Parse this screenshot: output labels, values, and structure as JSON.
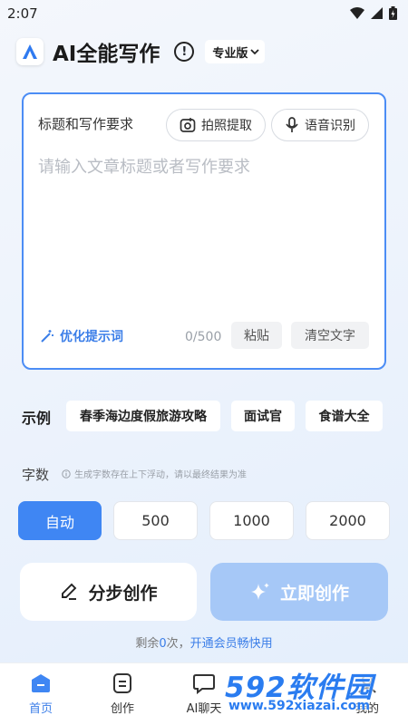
{
  "status_bar": {
    "time": "2:07"
  },
  "header": {
    "title": "AI全能写作",
    "info_glyph": "!",
    "edition": "专业版",
    "icons": [
      "app-logo-icon",
      "info-icon",
      "chevron-down-icon"
    ]
  },
  "editor": {
    "label": "标题和写作要求",
    "photo_extract": "拍照提取",
    "voice_recognition": "语音识别",
    "placeholder": "请输入文章标题或者写作要求",
    "optimize_prompt": "优化提示词",
    "char_count": "0/500",
    "paste": "粘贴",
    "clear": "清空文字"
  },
  "examples": {
    "label": "示例",
    "items": [
      "春季海边度假旅游攻略",
      "面试官",
      "食谱大全"
    ]
  },
  "word_count": {
    "label": "字数",
    "hint": "生成字数存在上下浮动，请以最终结果为准",
    "options": [
      "自动",
      "500",
      "1000",
      "2000"
    ],
    "selected": "自动"
  },
  "actions": {
    "step_create": "分步创作",
    "create_now": "立即创作"
  },
  "quota": {
    "prefix": "剩余",
    "count": "0",
    "suffix": "次，",
    "link": "开通会员畅快用"
  },
  "nav": {
    "items": [
      "首页",
      "创作",
      "AI聊天",
      "我的"
    ],
    "active": "首页"
  },
  "watermark": {
    "text": "592软件园",
    "url": "www.592xiazai.com"
  },
  "colors": {
    "accent": "#3f86f3",
    "accent_light": "#a6c8f7",
    "border_active": "#4c8df5"
  }
}
